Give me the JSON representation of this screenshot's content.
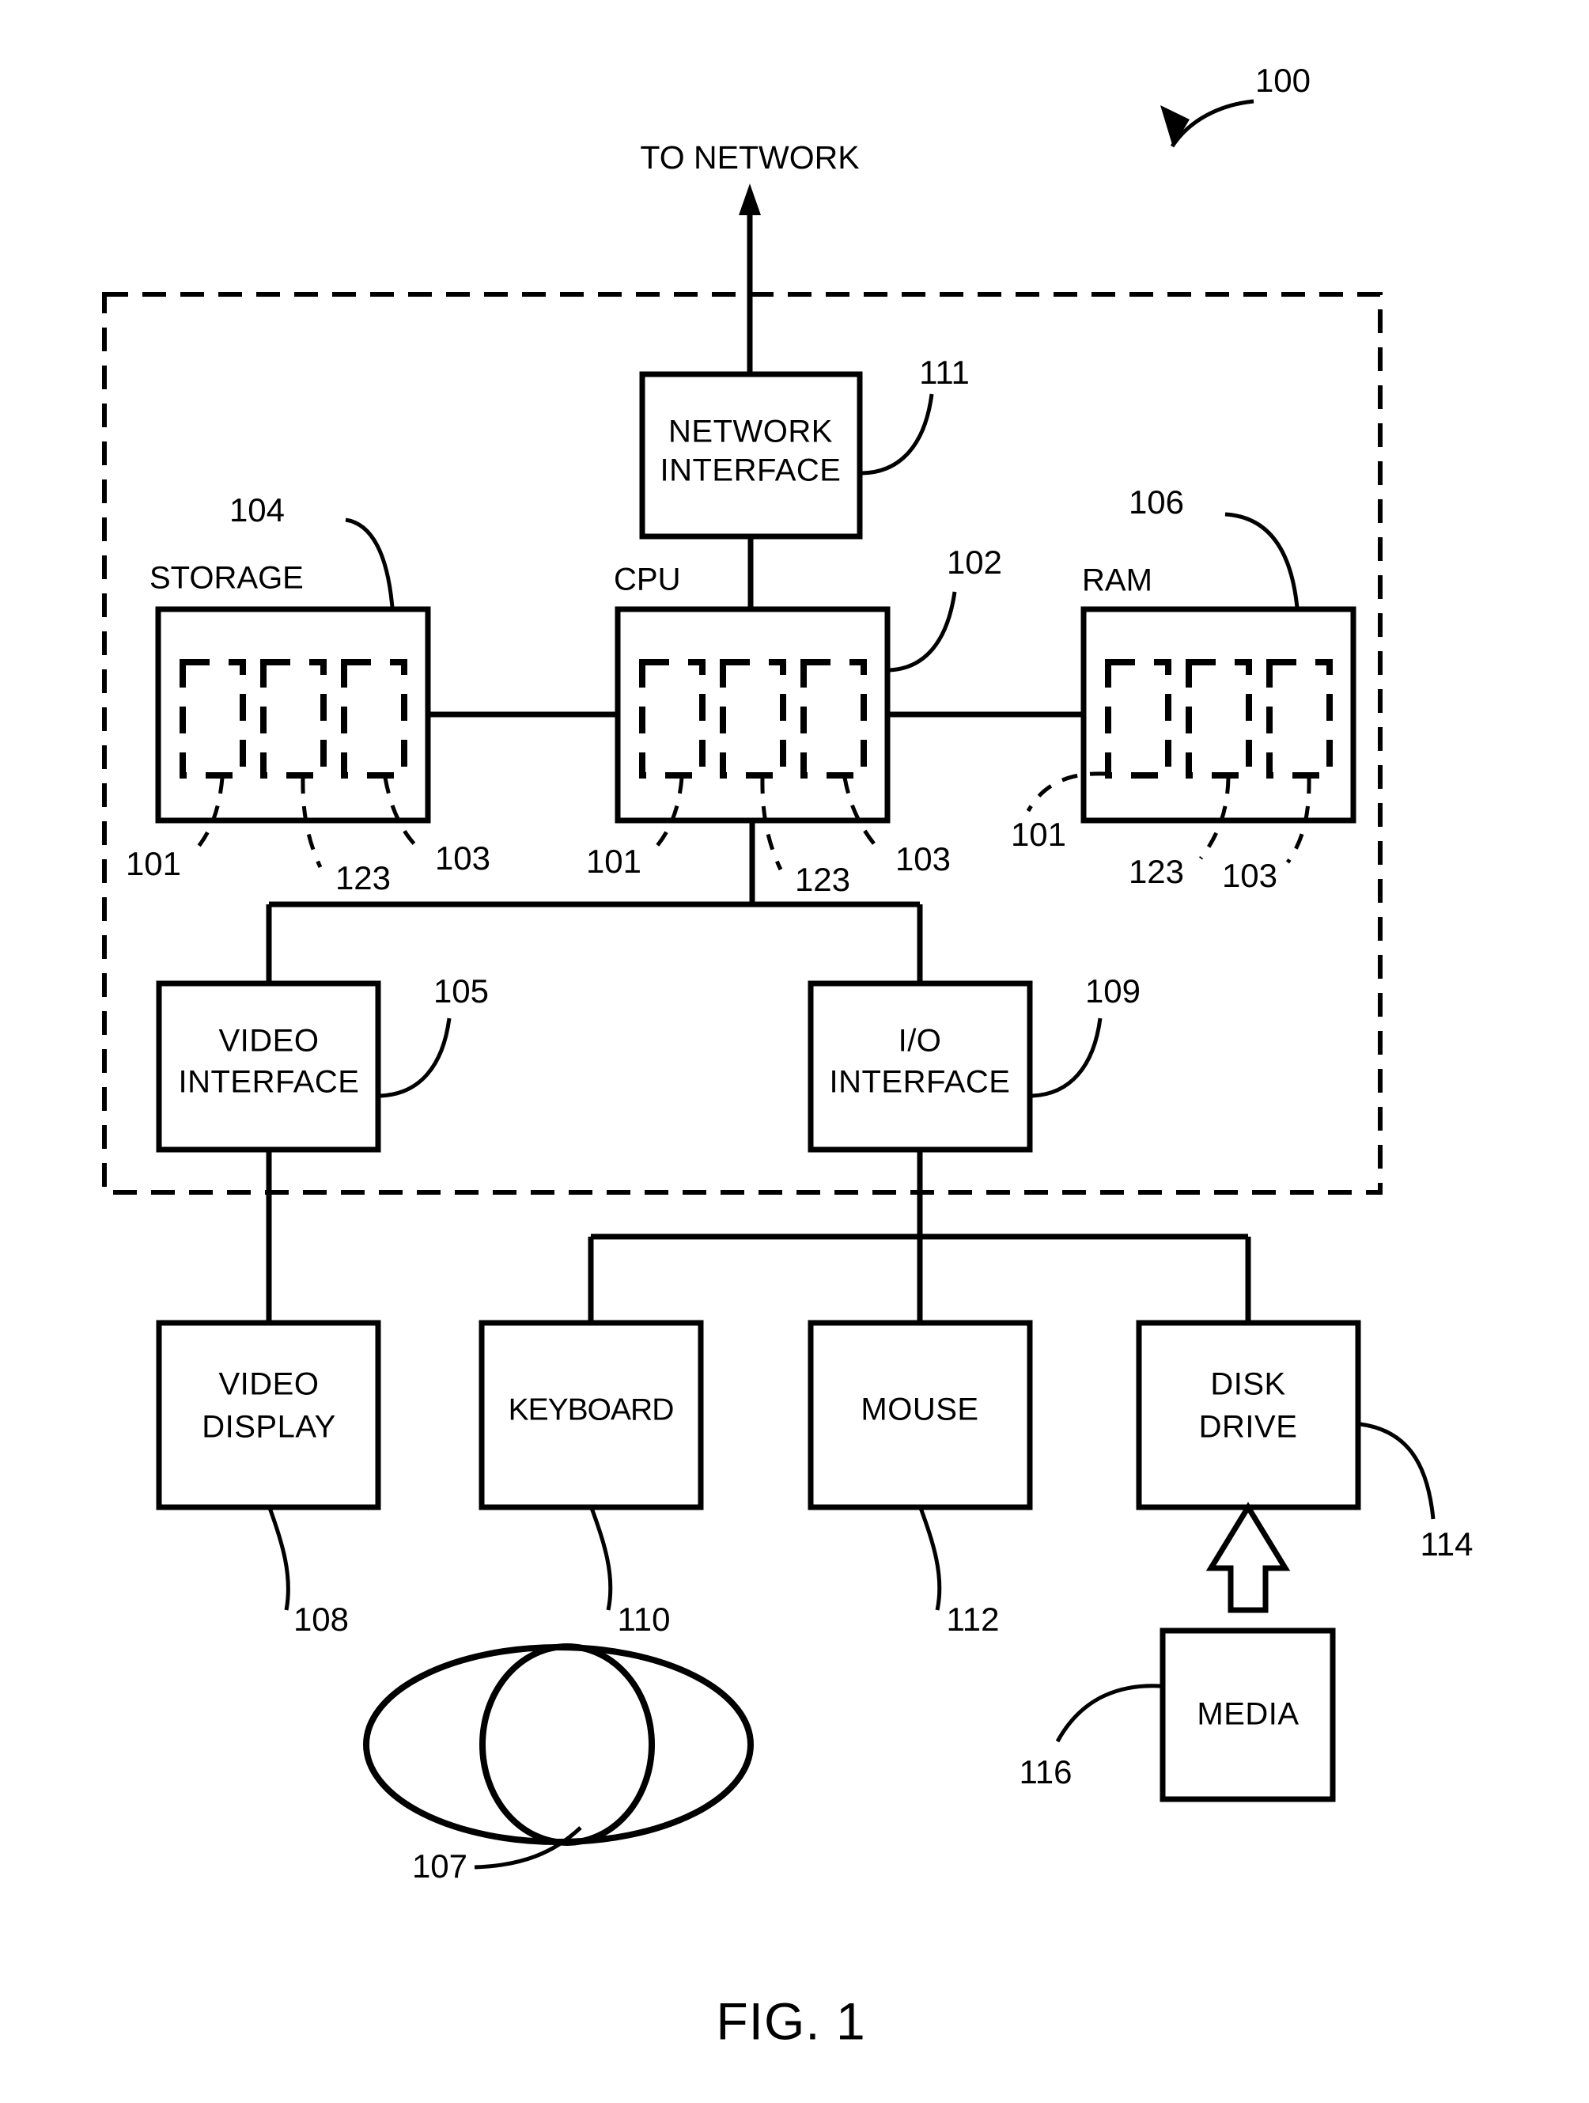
{
  "figure": {
    "caption": "FIG. 1",
    "system_ref": "100",
    "network_caption": "TO NETWORK"
  },
  "chassis": {
    "name": "computer-system-boundary",
    "style": "dashed"
  },
  "blocks": {
    "network_interface": {
      "label_line1": "NETWORK",
      "label_line2": "INTERFACE",
      "ref": "111"
    },
    "storage": {
      "title": "STORAGE",
      "ref": "104"
    },
    "cpu": {
      "title": "CPU",
      "ref": "102"
    },
    "ram": {
      "title": "RAM",
      "ref": "106"
    },
    "video_interface": {
      "label_line1": "VIDEO",
      "label_line2": "INTERFACE",
      "ref": "105"
    },
    "io_interface": {
      "label_line1": "I/O",
      "label_line2": "INTERFACE",
      "ref": "109"
    },
    "video_display": {
      "label_line1": "VIDEO",
      "label_line2": "DISPLAY",
      "ref": "108"
    },
    "keyboard": {
      "label_line1": "KEYBOARD",
      "label_line2": "",
      "ref": "110"
    },
    "mouse": {
      "label_line1": "MOUSE",
      "label_line2": "",
      "ref": "112"
    },
    "disk_drive": {
      "label_line1": "DISK",
      "label_line2": "DRIVE",
      "ref": "114"
    },
    "media": {
      "label_line1": "MEDIA",
      "label_line2": "",
      "ref": "116"
    },
    "eye": {
      "ref": "107"
    }
  },
  "inner_refs": {
    "storage": {
      "a": "101",
      "b": "123",
      "c": "103"
    },
    "cpu": {
      "a": "101",
      "b": "123",
      "c": "103"
    },
    "ram": {
      "a": "101",
      "b": "123",
      "c": "103"
    }
  }
}
